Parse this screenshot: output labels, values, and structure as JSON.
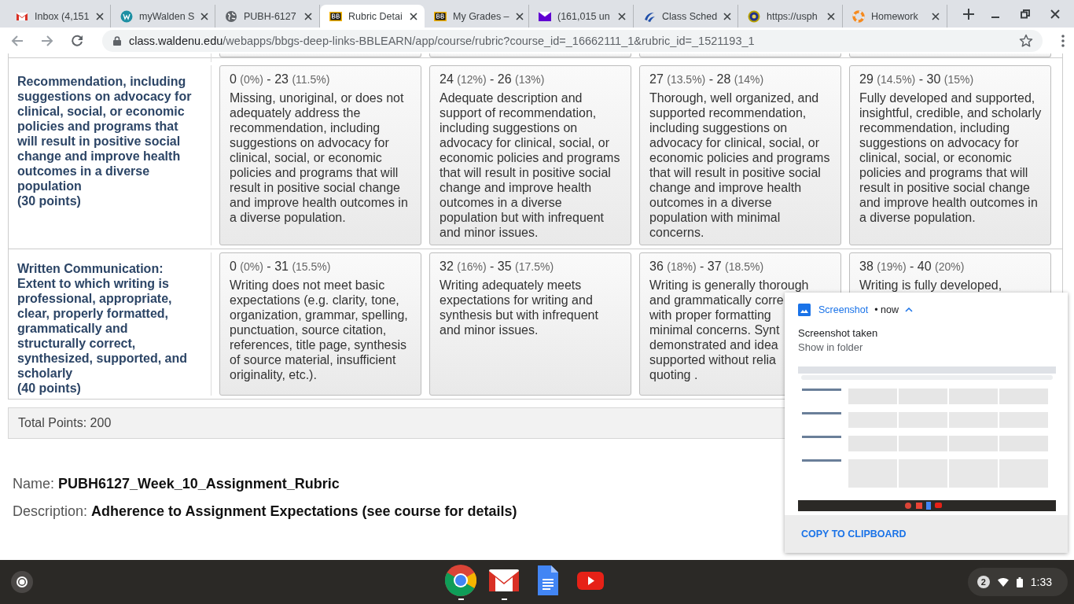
{
  "tabs": [
    {
      "kind": "gmail",
      "title": "Inbox (4,151",
      "selected": false
    },
    {
      "kind": "walden",
      "title": "myWalden S",
      "selected": false
    },
    {
      "kind": "globe",
      "title": "PUBH-6127",
      "selected": false
    },
    {
      "kind": "bb",
      "title": "Rubric Detai",
      "selected": true
    },
    {
      "kind": "bb",
      "title": "My Grades –",
      "selected": false
    },
    {
      "kind": "mail",
      "title": "(161,015 un",
      "selected": false
    },
    {
      "kind": "flame",
      "title": "Class Sched",
      "selected": false
    },
    {
      "kind": "seal",
      "title": "https://usph",
      "selected": false
    },
    {
      "kind": "ring",
      "title": "Homework",
      "selected": false
    }
  ],
  "address": {
    "host": "class.waldenu.edu",
    "path": "/webapps/bbgs-deep-links-BBLEARN/app/course/rubric?course_id=_16662111_1&rubric_id=_1521193_1"
  },
  "rubric": {
    "rows": [
      {
        "criterion": "Recommendation, including suggestions on advocacy for clinical, social, or economic policies and programs that will result in positive social change and improve health outcomes in a diverse population",
        "points": "(30 points)",
        "cells": [
          {
            "score": "0 (0%) - 23 (11.5%)",
            "description": "Missing, unoriginal, or does not adequately address the recommendation, including suggestions on advocacy for clinical, social, or economic policies and programs that will result in positive social change and improve health outcomes in a diverse population."
          },
          {
            "score": "24 (12%) - 26 (13%)",
            "description": "Adequate description and support of recommendation, including suggestions on advocacy for clinical, social, or economic policies and programs that will result in positive social change and improve health outcomes in a diverse population but with infrequent and minor issues."
          },
          {
            "score": "27 (13.5%) - 28 (14%)",
            "description": "Thorough, well organized, and supported recommendation, including suggestions on advocacy for clinical, social, or economic policies and programs that will result in positive social change and improve health outcomes in a diverse population with minimal concerns."
          },
          {
            "score": "29 (14.5%) - 30 (15%)",
            "description": "Fully developed and supported, insightful, credible, and scholarly recommendation, including suggestions on advocacy for clinical, social, or economic policies and programs that will result in positive social change and improve health outcomes in a diverse population."
          }
        ]
      },
      {
        "criterion": "Written Communication: Extent to which writing is professional, appropriate, clear, properly formatted, grammatically and structurally correct, synthesized, supported, and scholarly",
        "points": "(40 points)",
        "cells": [
          {
            "score": "0 (0%) - 31 (15.5%)",
            "description": "Writing does not meet basic expectations (e.g. clarity, tone, organization, grammar, spelling, punctuation, source citation, references, title page, synthesis of source material, insufficient originality, etc.)."
          },
          {
            "score": "32 (16%) - 35 (17.5%)",
            "description": "Writing adequately meets expectations  for writing and synthesis but with infrequent and minor issues."
          },
          {
            "score": "36 (18%) - 37 (18.5%)",
            "description_lines": [
              "Writing is generally thorough",
              "and grammatically corre",
              "with proper formatting",
              "minimal concerns. Synt",
              "demonstrated and idea",
              "supported without relia",
              "quoting ."
            ]
          },
          {
            "score": "38 (19%) - 40 (20%)",
            "description": "Writing is fully developed,"
          }
        ]
      }
    ]
  },
  "total": "Total Points: 200",
  "meta": [
    {
      "label": "Name:",
      "value": "PUBH6127_Week_10_Assignment_Rubric"
    },
    {
      "label": "Description:",
      "value": "Adherence to Assignment Expectations (see course for details)"
    }
  ],
  "notification": {
    "app": "Screenshot",
    "time": "• now",
    "expanded": true,
    "title": "Screenshot taken",
    "message": "Show in folder",
    "action": "COPY TO CLIPBOARD"
  },
  "shelf": {
    "apps": [
      {
        "kind": "chrome",
        "running": true
      },
      {
        "kind": "gmail",
        "running": true
      },
      {
        "kind": "docs",
        "running": false
      },
      {
        "kind": "youtube",
        "running": false
      }
    ],
    "notifications": "2",
    "time": "1:33"
  }
}
